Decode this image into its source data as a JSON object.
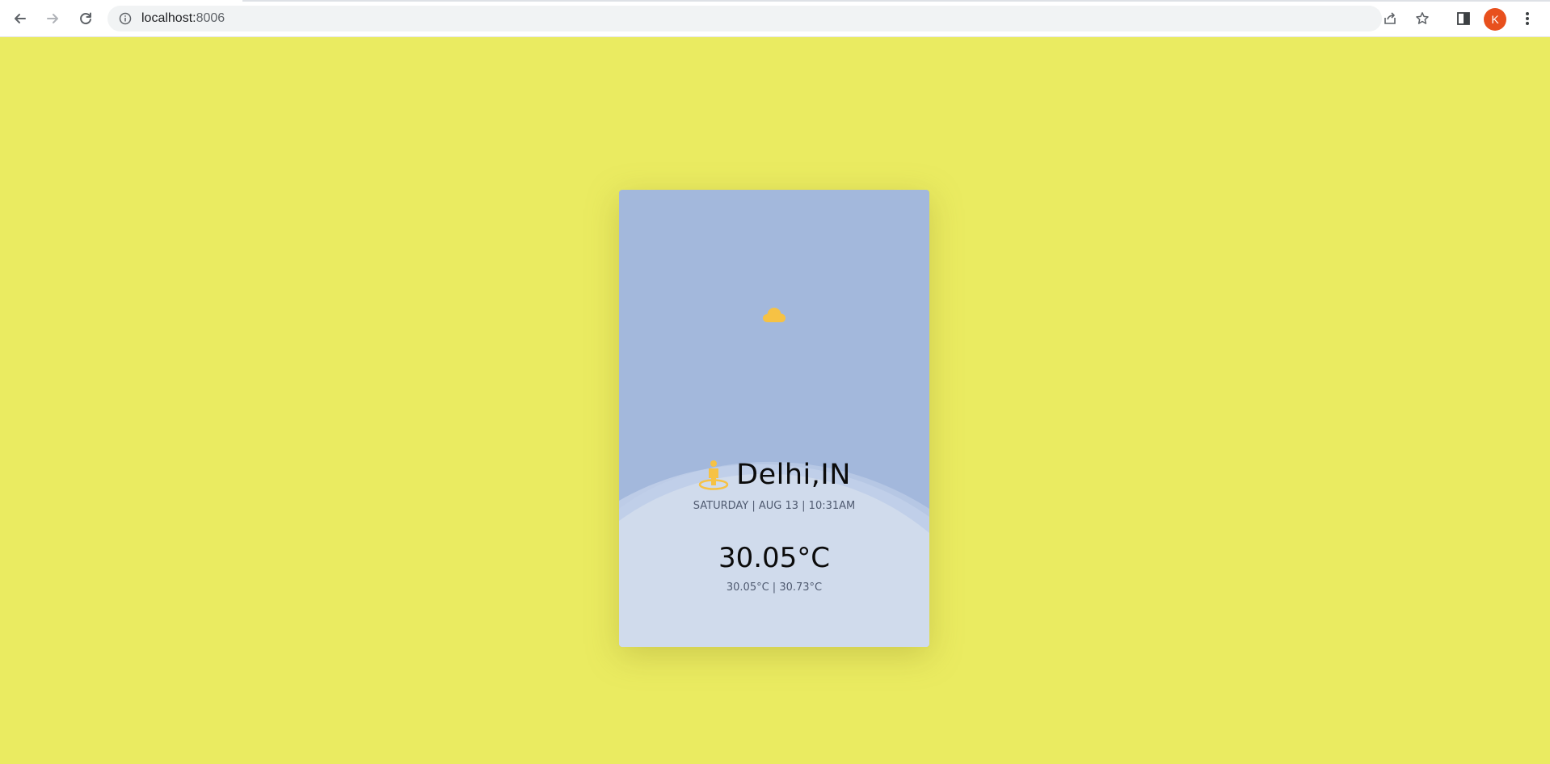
{
  "browser": {
    "url_host": "localhost:",
    "url_port": "8006",
    "profile_initial": "K",
    "icons": {
      "back": "arrow-left-icon",
      "forward": "arrow-right-icon",
      "reload": "reload-icon",
      "site_info": "info-icon",
      "share": "share-icon",
      "bookmark": "star-icon",
      "side_panel": "side-panel-icon",
      "menu": "kebab-menu-icon"
    }
  },
  "weather": {
    "city": "Delhi,IN",
    "datetime": "SATURDAY | AUG 13 | 10:31AM",
    "temperature": "30.05°C",
    "range": "30.05°C | 30.73°C",
    "condition_icon": "cloud-icon",
    "location_icon": "person-pin-icon"
  },
  "colors": {
    "page_background": "#eaeb61",
    "card_sky": "#a3b8dc",
    "card_ground": "#d0dbec",
    "accent_icon": "#f6c244",
    "avatar": "#e8501d"
  }
}
